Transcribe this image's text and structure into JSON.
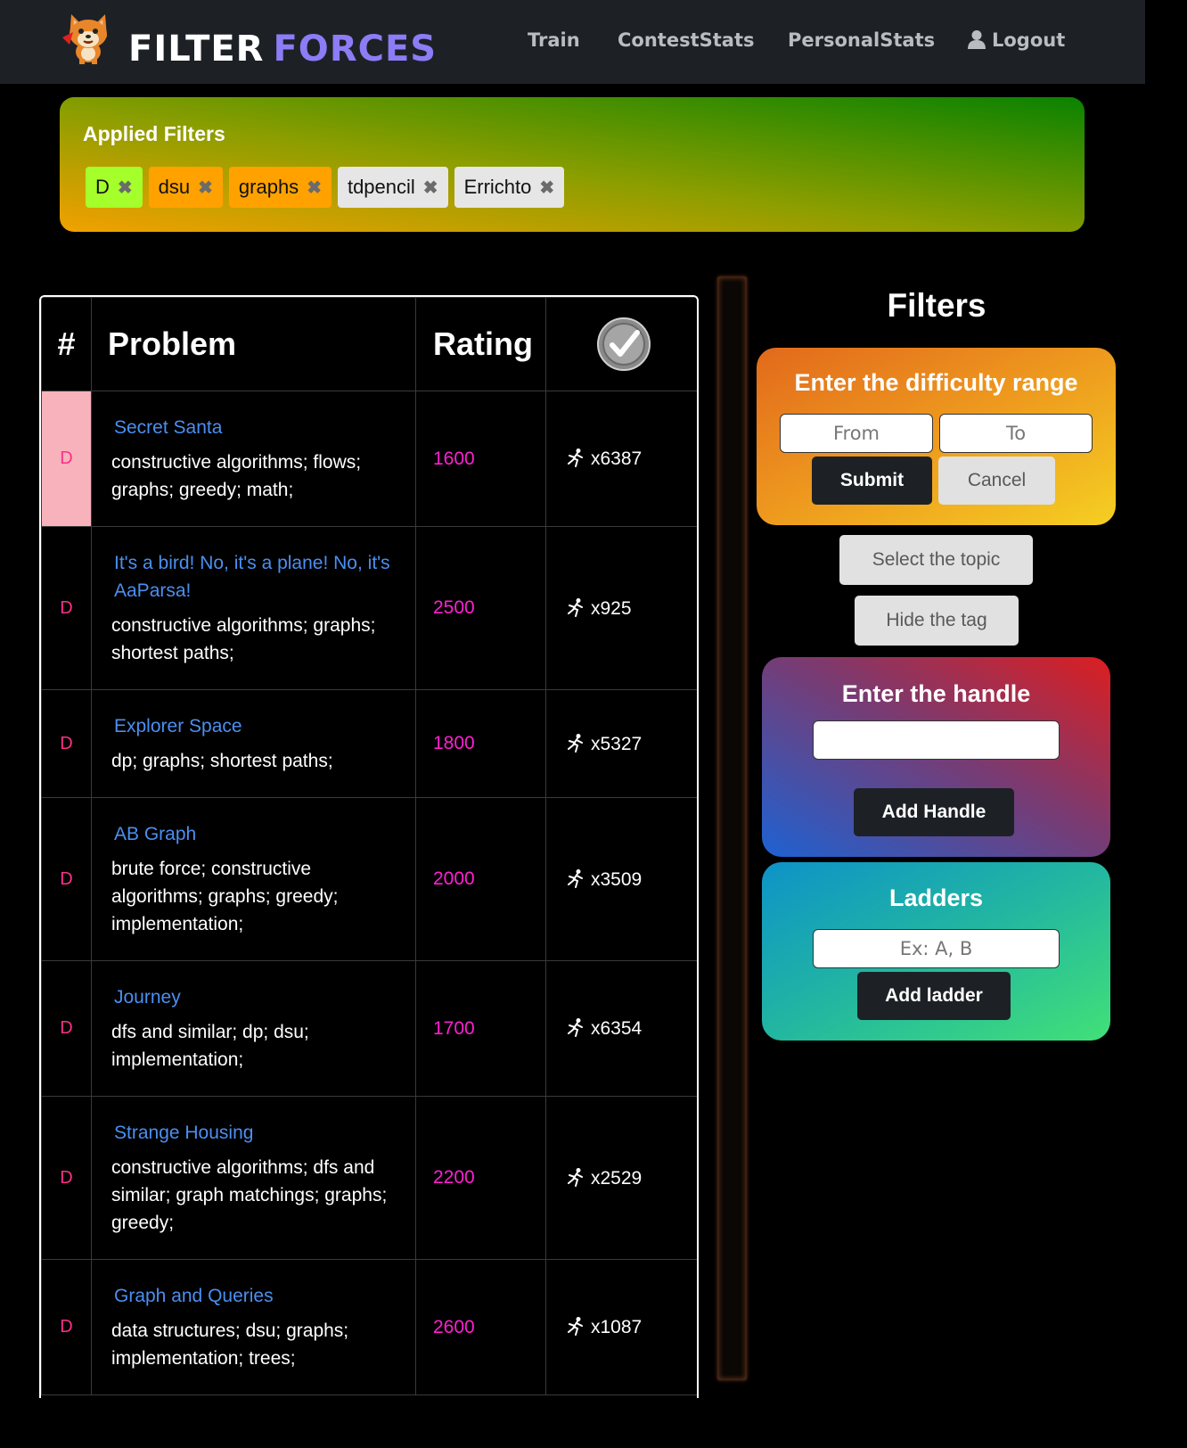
{
  "navbar": {
    "logo_word1": "FILTER",
    "logo_word2": "FORCES",
    "links": [
      "Train",
      "ContestStats",
      "PersonalStats",
      "Logout"
    ]
  },
  "applied_filters": {
    "title": "Applied Filters",
    "chips": [
      {
        "label": "D",
        "color": "#a4ff2a"
      },
      {
        "label": "dsu",
        "color": "#ffa200"
      },
      {
        "label": "graphs",
        "color": "#ffa200"
      },
      {
        "label": "tdpencil",
        "color": "#e6e6e6"
      },
      {
        "label": "Errichto",
        "color": "#e6e6e6"
      }
    ],
    "remove_icon": "✖"
  },
  "table": {
    "headers": {
      "index": "#",
      "problem": "Problem",
      "rating": "Rating",
      "solved_icon": "check-circle-icon"
    },
    "rows": [
      {
        "index": "D",
        "name": "Secret Santa",
        "tags": "constructive algorithms; flows; graphs; greedy; math;",
        "rating": "1600",
        "solved": "x6387",
        "highlight": true
      },
      {
        "index": "D",
        "name": "It's a bird! No, it's a plane! No, it's AaParsa!",
        "tags": "constructive algorithms; graphs; shortest paths;",
        "rating": "2500",
        "solved": "x925",
        "highlight": false
      },
      {
        "index": "D",
        "name": "Explorer Space",
        "tags": "dp; graphs; shortest paths;",
        "rating": "1800",
        "solved": "x5327",
        "highlight": false
      },
      {
        "index": "D",
        "name": "AB Graph",
        "tags": "brute force; constructive algorithms; graphs; greedy; implementation;",
        "rating": "2000",
        "solved": "x3509",
        "highlight": false
      },
      {
        "index": "D",
        "name": "Journey",
        "tags": "dfs and similar; dp; dsu; implementation;",
        "rating": "1700",
        "solved": "x6354",
        "highlight": false
      },
      {
        "index": "D",
        "name": "Strange Housing",
        "tags": "constructive algorithms; dfs and similar; graph matchings; graphs; greedy;",
        "rating": "2200",
        "solved": "x2529",
        "highlight": false
      },
      {
        "index": "D",
        "name": "Graph and Queries",
        "tags": "data structures; dsu; graphs; implementation; trees;",
        "rating": "2600",
        "solved": "x1087",
        "highlight": false
      }
    ]
  },
  "filters_panel": {
    "title": "Filters",
    "difficulty": {
      "title": "Enter the difficulty range",
      "from_placeholder": "From",
      "to_placeholder": "To",
      "submit": "Submit",
      "cancel": "Cancel"
    },
    "select_topic": "Select the topic",
    "hide_tag": "Hide the tag",
    "handle": {
      "title": "Enter the handle",
      "value": "",
      "button": "Add Handle"
    },
    "ladders": {
      "title": "Ladders",
      "placeholder": "Ex: A, B",
      "button": "Add ladder"
    }
  },
  "colors": {
    "index": "#ff2f87",
    "problem_link": "#4b8ff0",
    "rating": "#ff1fd2",
    "highlight_row": "#f7b2bb"
  }
}
